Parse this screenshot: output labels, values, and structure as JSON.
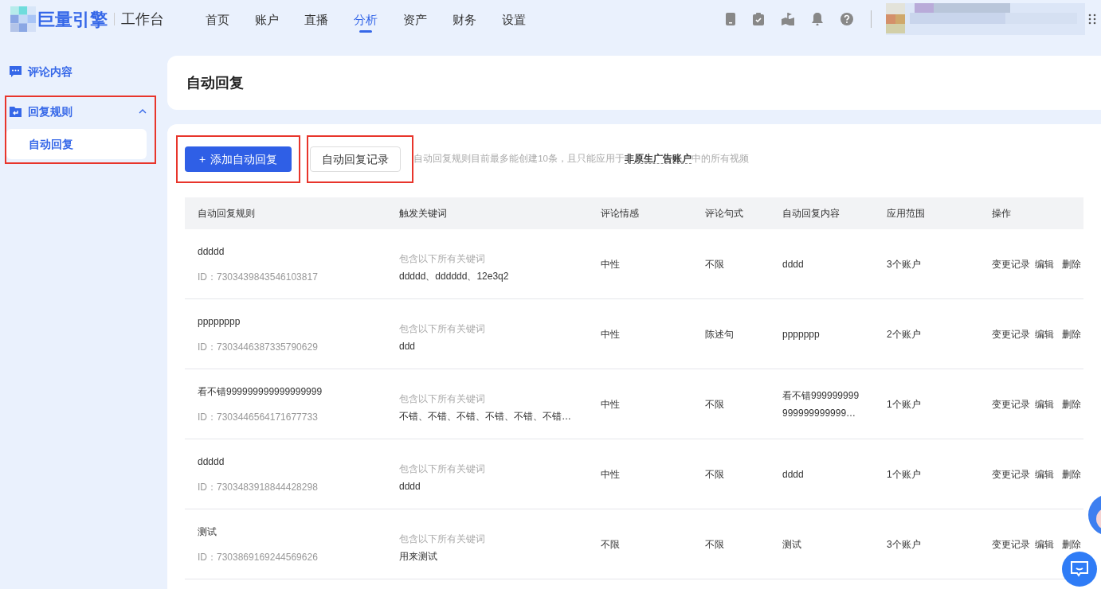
{
  "brand": {
    "logo": "巨量引擎",
    "product": "工作台"
  },
  "nav": [
    {
      "label": "首页",
      "selected": false
    },
    {
      "label": "账户",
      "selected": false
    },
    {
      "label": "直播",
      "selected": false
    },
    {
      "label": "分析",
      "selected": true
    },
    {
      "label": "资产",
      "selected": false
    },
    {
      "label": "财务",
      "selected": false
    },
    {
      "label": "设置",
      "selected": false
    }
  ],
  "sidebar": {
    "items": [
      {
        "label": "评论内容",
        "kind": "link",
        "highlighted": false
      },
      {
        "label": "回复规则",
        "kind": "group",
        "expanded": true,
        "highlighted": true,
        "children": [
          {
            "label": "自动回复",
            "selected": true
          }
        ]
      }
    ]
  },
  "page_title": "自动回复",
  "toolbar": {
    "add_button": {
      "icon": "+",
      "label": "添加自动回复",
      "highlighted": true
    },
    "record_button": {
      "label": "自动回复记录",
      "highlighted": true
    },
    "note": "自动回复规则目前最多能创建10条，且只能应用于**非原生广告账户**中的所有视频"
  },
  "table": {
    "columns": [
      "自动回复规则",
      "触发关键词",
      "评论情感",
      "评论句式",
      "自动回复内容",
      "应用范围",
      "操作"
    ],
    "rows": [
      {
        "name": "ddddd",
        "id": "ID：7303439843546103817",
        "keyword_hint": "包含以下所有关键词",
        "keywords": "ddddd、dddddd、12e3q2",
        "sentiment": "中性",
        "sentence": "不限",
        "content": [
          "dddd"
        ],
        "scope": "3个账户",
        "actions": [
          "变更记录",
          "编辑",
          "删除"
        ]
      },
      {
        "name": "pppppppp",
        "id": "ID：7303446387335790629",
        "keyword_hint": "包含以下所有关键词",
        "keywords": "ddd",
        "sentiment": "中性",
        "sentence": "陈述句",
        "content": [
          "ppppppp"
        ],
        "scope": "2个账户",
        "actions": [
          "变更记录",
          "编辑",
          "删除"
        ]
      },
      {
        "name": "看不错999999999999999999",
        "id": "ID：7303446564171677733",
        "keyword_hint": "包含以下所有关键词",
        "keywords": "不错、不错、不错、不错、不错、不错…",
        "sentiment": "中性",
        "sentence": "不限",
        "content": [
          "看不错999999999",
          "999999999999…"
        ],
        "scope": "1个账户",
        "actions": [
          "变更记录",
          "编辑",
          "删除"
        ]
      },
      {
        "name": "ddddd",
        "id": "ID：7303483918844428298",
        "keyword_hint": "包含以下所有关键词",
        "keywords": "dddd",
        "sentiment": "中性",
        "sentence": "不限",
        "content": [
          "dddd"
        ],
        "scope": "1个账户",
        "actions": [
          "变更记录",
          "编辑",
          "删除"
        ]
      },
      {
        "name": "测试",
        "id": "ID：7303869169244569626",
        "keyword_hint": "包含以下所有关键词",
        "keywords": "用来测试",
        "sentiment": "不限",
        "sentence": "不限",
        "content": [
          "测试"
        ],
        "scope": "3个账户",
        "actions": [
          "变更记录",
          "编辑",
          "删除"
        ]
      }
    ]
  }
}
